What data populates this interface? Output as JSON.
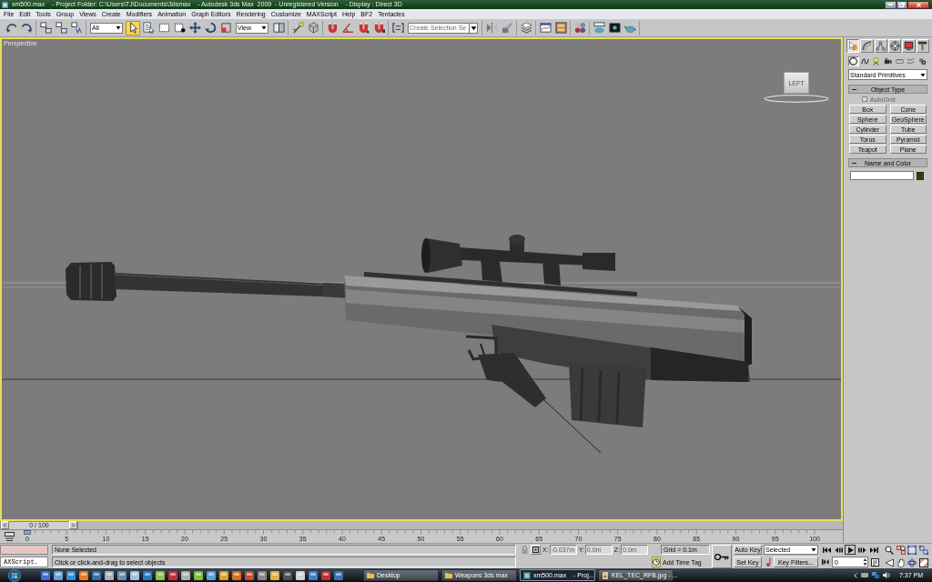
{
  "window": {
    "title": "xm500.max    - Project Folder: C:\\Users\\TJ\\Documents\\3dsmax    - Autodesk 3ds Max  2009  - Unregistered Version    - Display : Direct 3D"
  },
  "menu": [
    "File",
    "Edit",
    "Tools",
    "Group",
    "Views",
    "Create",
    "Modifiers",
    "Animation",
    "Graph Editors",
    "Rendering",
    "Customize",
    "MAXScript",
    "Help",
    "BF2",
    "Tentacles"
  ],
  "toolbar": {
    "groups": [
      {
        "items": [
          {
            "kind": "tool",
            "selected": false
          },
          {
            "kind": "tool",
            "selected": false
          }
        ]
      },
      {
        "items": [
          {
            "kind": "tool",
            "selected": false
          },
          {
            "kind": "tool",
            "selected": false
          },
          {
            "kind": "tool",
            "selected": false
          }
        ]
      },
      {
        "items": [
          {
            "kind": "dropdown",
            "value": "All"
          },
          {
            "kind": "tool",
            "selected": true
          },
          {
            "kind": "tool",
            "selected": false
          },
          {
            "kind": "tool",
            "selected": false
          },
          {
            "kind": "tool",
            "selected": false
          },
          {
            "kind": "tool",
            "selected": false
          },
          {
            "kind": "tool",
            "selected": false
          },
          {
            "kind": "tool",
            "selected": false
          },
          {
            "kind": "dropdown",
            "value": "View"
          },
          {
            "kind": "tool",
            "selected": false
          }
        ]
      },
      {
        "items": [
          {
            "kind": "tool",
            "selected": false
          },
          {
            "kind": "tool",
            "selected": false
          }
        ]
      },
      {
        "items": [
          {
            "kind": "tool",
            "selected": false
          },
          {
            "kind": "tool",
            "selected": false
          },
          {
            "kind": "tool",
            "selected": false
          },
          {
            "kind": "tool",
            "selected": false
          }
        ]
      },
      {
        "items": [
          {
            "kind": "tool",
            "selected": false
          },
          {
            "kind": "combo",
            "placeholder": "Create Selection Se"
          }
        ]
      },
      {
        "items": [
          {
            "kind": "tool",
            "selected": false
          },
          {
            "kind": "tool",
            "selected": false
          }
        ]
      },
      {
        "items": [
          {
            "kind": "tool",
            "selected": false
          }
        ]
      },
      {
        "items": [
          {
            "kind": "tool",
            "selected": false
          },
          {
            "kind": "tool",
            "selected": false
          }
        ]
      },
      {
        "items": [
          {
            "kind": "tool",
            "selected": false
          }
        ]
      },
      {
        "items": [
          {
            "kind": "tool",
            "selected": false
          },
          {
            "kind": "tool",
            "selected": false
          },
          {
            "kind": "tool",
            "selected": false
          }
        ]
      }
    ]
  },
  "viewport": {
    "label": "Perspective",
    "active": true,
    "viewcube": {
      "face": "LEFT"
    }
  },
  "command_panel": {
    "tabs": [
      {
        "selected": true
      },
      {
        "selected": false
      },
      {
        "selected": false
      },
      {
        "selected": false
      },
      {
        "selected": false
      },
      {
        "selected": false
      }
    ],
    "categories": [
      {
        "selected": true
      },
      {
        "selected": false
      },
      {
        "selected": false
      },
      {
        "selected": false
      },
      {
        "selected": false
      },
      {
        "selected": false
      },
      {
        "selected": false
      }
    ],
    "type_list": {
      "value": "Standard Primitives"
    },
    "rollouts": [
      {
        "kind": "object_type",
        "title": "Object Type",
        "expanded": true,
        "autogrid": {
          "label": "AutoGrid",
          "checked": false,
          "disabled": true
        },
        "buttons": [
          "Box",
          "Cone",
          "Sphere",
          "GeoSphere",
          "Cylinder",
          "Tube",
          "Torus",
          "Pyramid",
          "Teapot",
          "Plane"
        ]
      },
      {
        "kind": "name_color",
        "title": "Name and Color",
        "expanded": true
      }
    ]
  },
  "time_slider": {
    "prev": "<",
    "label": "0 / 100",
    "next": ">",
    "level": 0
  },
  "track_bar": {
    "ticks": [
      "0",
      "5",
      "10",
      "15",
      "20",
      "25",
      "30",
      "35",
      "40",
      "45",
      "50",
      "55",
      "60",
      "65",
      "70",
      "75",
      "80",
      "85",
      "90",
      "95",
      "100"
    ]
  },
  "status_bar": {
    "listener": {
      "input": "AXScript."
    },
    "selection": "None Selected",
    "prompt": "Click or click-and-drag to select objects",
    "coordinates": [
      {
        "axis": "X:",
        "value": "-0.037m",
        "disabled": true
      },
      {
        "axis": "Y:",
        "value": "0.0m",
        "disabled": true
      },
      {
        "axis": "Z:",
        "value": "0.0m",
        "disabled": true
      }
    ],
    "grid": "Grid = 0.1m",
    "time_tag": "Add Time Tag",
    "auto_key": {
      "label": "Auto Key",
      "on": false
    },
    "key_set": "Selected",
    "set_key": "Set Key",
    "key_filters": "Key Filters...",
    "frame": "0"
  },
  "taskbar": {
    "tasks": [
      {
        "label": "Desktop",
        "selected": false
      },
      {
        "label": "Weapons 3ds max",
        "selected": false
      },
      {
        "label": "xm500.max    - Proj...",
        "selected": true
      },
      {
        "label": "KEL_TEC_RFB.jpg - ...",
        "selected": false
      }
    ],
    "clock": "7:37 PM"
  }
}
